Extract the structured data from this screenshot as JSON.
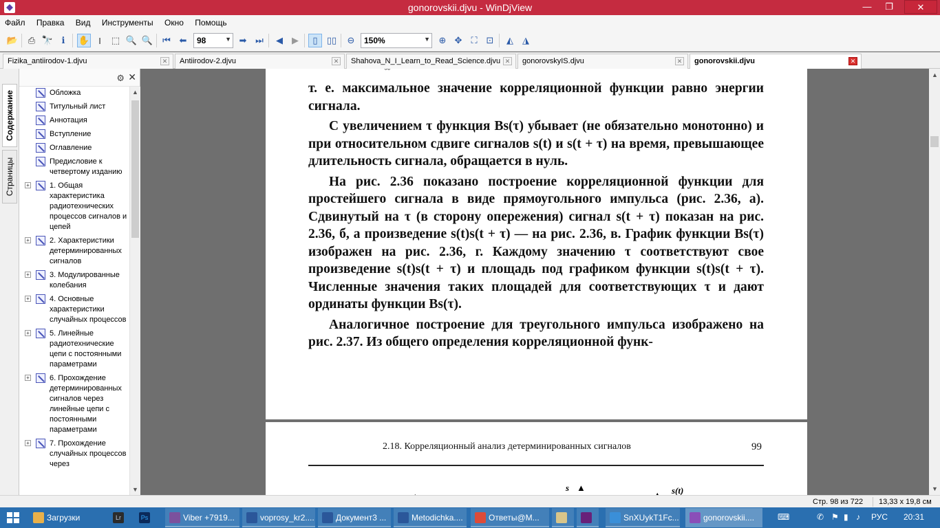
{
  "window": {
    "title": "gonorovskii.djvu - WinDjView",
    "min": "—",
    "max": "❐",
    "close": "✕"
  },
  "menu": [
    "Файл",
    "Правка",
    "Вид",
    "Инструменты",
    "Окно",
    "Помощь"
  ],
  "toolbar": {
    "page_value": "98",
    "zoom_value": "150%",
    "icons": [
      "open-icon",
      "print-icon",
      "find-icon",
      "info-icon",
      "hand-icon",
      "select-text-icon",
      "select-rect-icon",
      "zoom-in-tool-icon",
      "zoom-out-tool-icon",
      "first-page-icon",
      "prev-page-icon",
      "next-page-icon",
      "last-page-icon",
      "back-icon",
      "forward-icon",
      "single-page-icon",
      "two-page-icon",
      "zoom-out-icon",
      "zoom-in-icon",
      "fit-width-icon",
      "fit-page-icon",
      "actual-size-icon",
      "rotate-left-icon",
      "rotate-right-icon"
    ]
  },
  "tabs": [
    {
      "label": "Fizika_antiirodov-1.djvu"
    },
    {
      "label": "Antiirodov-2.djvu"
    },
    {
      "label": "Shahova_N_I_Learn_to_Read_Science.djvu"
    },
    {
      "label": "gonorovskyIS.djvu"
    },
    {
      "label": "gonorovskii.djvu"
    }
  ],
  "sidetabs": {
    "contents": "Содержание",
    "pages": "Страницы"
  },
  "toc": [
    {
      "label": "Обложка",
      "expand": false
    },
    {
      "label": "Титульный лист",
      "expand": false
    },
    {
      "label": "Аннотация",
      "expand": false
    },
    {
      "label": "Вступление",
      "expand": false
    },
    {
      "label": "Оглавление",
      "expand": false
    },
    {
      "label": "Предисловие к четвертому изданию",
      "expand": false
    },
    {
      "label": "1. Общая характеристика радиотехнических процессов сигналов и цепей",
      "expand": true
    },
    {
      "label": "2. Характеристики детерминированных сигналов",
      "expand": true
    },
    {
      "label": "3. Модулированные колебания",
      "expand": true
    },
    {
      "label": "4. Основные характеристики случайных процессов",
      "expand": true
    },
    {
      "label": "5. Линейные радиотехнические цепи с постоянными параметрами",
      "expand": true
    },
    {
      "label": "6. Прохождение детерминированных сигналов через линейные цепи с постоянными параметрами",
      "expand": true
    },
    {
      "label": "7. Прохождение случайных процессов через",
      "expand": true
    }
  ],
  "document": {
    "top_mark": "−∞",
    "paragraphs": [
      "т. е. максимальное значение корреляционной функции равно энергии сигнала.",
      "С увеличением τ функция Bs(τ) убывает (не обязательно монотонно) и при относительном сдвиге сигналов s(t) и s(t + τ) на время, превышающее длительность сигнала, обращается в нуль.",
      "На рис. 2.36 показано построение корреляционной функции для простейшего сигнала в виде прямоугольного импульса (рис. 2.36, а). Сдвинутый на τ (в сторону опережения) сигнал s(t + τ) показан на рис. 2.36, б, а произведение s(t)s(t + τ) — на рис. 2.36, в. График функции Bs(τ) изображен на рис. 2.36, г. Каждому значению τ соответствуют свое произведение s(t)s(t + τ) и площадь под графиком функции s(t)s(t + τ). Численные значения таких площадей для соответствующих τ и дают ординаты функции Bs(τ).",
      "Аналогичное построение для треугольного импульса изображено на рис. 2.37. Из общего определения корреляционной функ-"
    ],
    "running_head": "2.18. Корреляционный анализ детерминированных сигналов",
    "page_number": "99",
    "fig_s": "s",
    "fig_st": "s(t)"
  },
  "status": {
    "page": "Стр. 98 из 722",
    "size": "13,33 x 19,8 см"
  },
  "taskbar": {
    "items": [
      {
        "label": "Загрузки",
        "color": "#e8b04a"
      },
      {
        "label": "",
        "color": "#2b2b2b"
      },
      {
        "label": "",
        "color": "#0b2a5a"
      },
      {
        "label": "Viber +7919...",
        "color": "#7b519d"
      },
      {
        "label": "voprosy_kr2....",
        "color": "#2b579a"
      },
      {
        "label": "Документ3 ...",
        "color": "#2b579a"
      },
      {
        "label": "Metodichka....",
        "color": "#2b579a"
      },
      {
        "label": "Ответы@M...",
        "color": "#dd4b39"
      },
      {
        "label": "",
        "color": "#d8c58a"
      },
      {
        "label": "",
        "color": "#68217a"
      },
      {
        "label": "SnXUykT1Fc...",
        "color": "#3a8fd8"
      },
      {
        "label": "gonorovskii....",
        "color": "#8a4fb8"
      }
    ],
    "app_letters": {
      "lr": "Lr",
      "ps": "Ps"
    },
    "lang": "РУС",
    "time": "20:31"
  }
}
